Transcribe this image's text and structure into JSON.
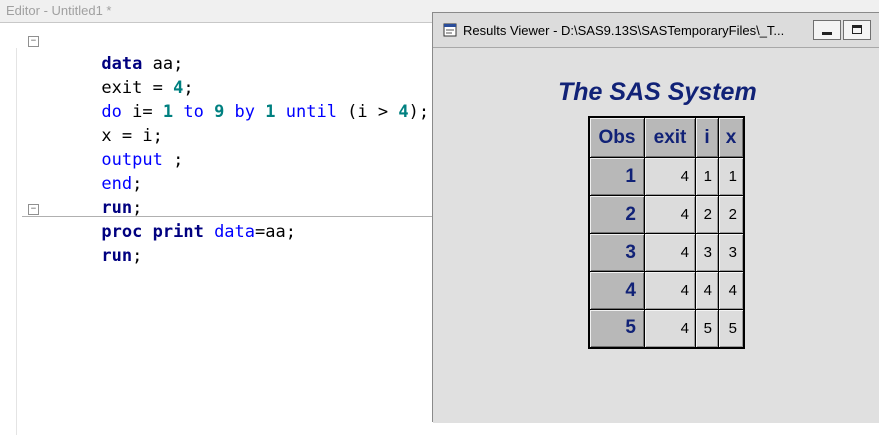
{
  "editor": {
    "title": "Editor - Untitled1 *",
    "code": {
      "l1": {
        "kw": "data",
        "rest": " aa;"
      },
      "l2": {
        "pre": "exit = ",
        "num": "4",
        "post": ";"
      },
      "l3": {
        "kw1": "do",
        "a": " i= ",
        "n1": "1",
        "kw2": " to ",
        "n2": "9",
        "kw3": " by ",
        "n3": "1",
        "kw4": " until",
        "b": " (i > ",
        "n4": "4",
        "c": ");"
      },
      "l4": {
        "text": "x = i;"
      },
      "l5": {
        "kw": "output",
        "rest": " ;"
      },
      "l6": {
        "kw": "end",
        "rest": ";"
      },
      "l7": {
        "kw": "run",
        "rest": ";"
      },
      "l8": {
        "kw1": "proc",
        "sp": " ",
        "kw2": "print",
        "sp2": " ",
        "kw3": "data",
        "rest": "=aa;"
      },
      "l9": {
        "kw": "run",
        "rest": ";"
      }
    }
  },
  "results": {
    "title": "Results Viewer - D:\\SAS9.13S\\SASTemporaryFiles\\_T...",
    "report_title": "The SAS System",
    "table": {
      "headers": [
        "Obs",
        "exit",
        "i",
        "x"
      ],
      "rows": [
        [
          "1",
          "4",
          "1",
          "1"
        ],
        [
          "2",
          "4",
          "2",
          "2"
        ],
        [
          "3",
          "4",
          "3",
          "3"
        ],
        [
          "4",
          "4",
          "4",
          "4"
        ],
        [
          "5",
          "4",
          "5",
          "5"
        ]
      ]
    }
  },
  "icons": [
    "fold-toggle-icon",
    "results-viewer-app-icon",
    "minimize-icon",
    "maximize-icon"
  ]
}
